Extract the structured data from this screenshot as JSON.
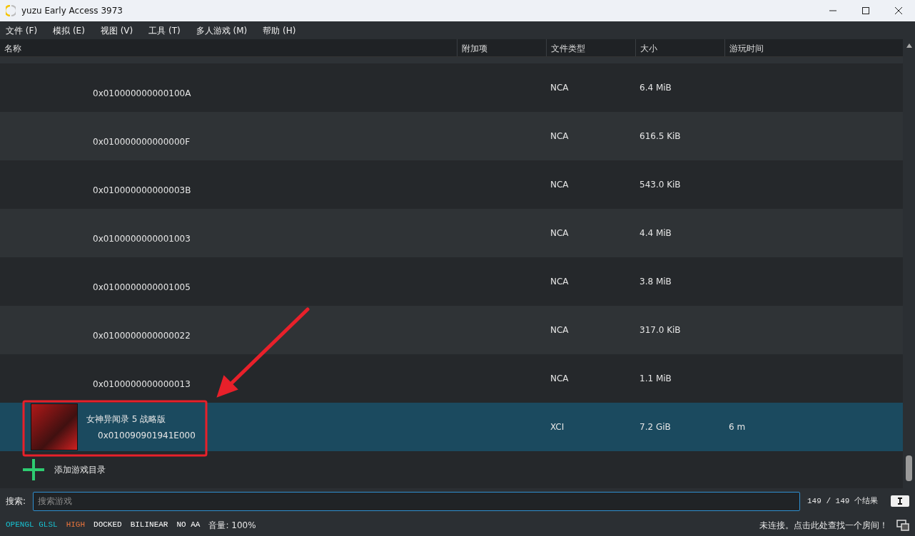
{
  "window": {
    "title": "yuzu Early Access 3973"
  },
  "menu": [
    "文件 (F)",
    "模拟 (E)",
    "视图 (V)",
    "工具 (T)",
    "多人游戏 (M)",
    "帮助 (H)"
  ],
  "table": {
    "columns": [
      "名称",
      "附加项",
      "文件类型",
      "大小",
      "游玩时间"
    ],
    "rows": [
      {
        "kind": "file",
        "id": "0x010000000000100A",
        "file_type": "NCA",
        "size": "6.4 MiB",
        "selected": false
      },
      {
        "kind": "file",
        "id": "0x010000000000000F",
        "file_type": "NCA",
        "size": "616.5 KiB",
        "selected": false
      },
      {
        "kind": "file",
        "id": "0x010000000000003B",
        "file_type": "NCA",
        "size": "543.0 KiB",
        "selected": false
      },
      {
        "kind": "file",
        "id": "0x0100000000001003",
        "file_type": "NCA",
        "size": "4.4 MiB",
        "selected": false
      },
      {
        "kind": "file",
        "id": "0x0100000000001005",
        "file_type": "NCA",
        "size": "3.8 MiB",
        "selected": false
      },
      {
        "kind": "file",
        "id": "0x0100000000000022",
        "file_type": "NCA",
        "size": "317.0 KiB",
        "selected": false
      },
      {
        "kind": "file",
        "id": "0x0100000000000013",
        "file_type": "NCA",
        "size": "1.1 MiB",
        "selected": false
      },
      {
        "kind": "game",
        "title": "女神异闻录 5  战略版",
        "id": "0x010090901941E000",
        "file_type": "XCI",
        "size": "7.2 GiB",
        "play_time": "6 m",
        "selected": true
      }
    ],
    "add_directory": "添加游戏目录"
  },
  "search": {
    "label": "搜索:",
    "placeholder": "搜索游戏",
    "result_count": "149 / 149 个结果"
  },
  "status_bar": {
    "items": [
      {
        "text": "OPENGL GLSL",
        "color": "#18c0d0"
      },
      {
        "text": "HIGH",
        "color": "#e8743c"
      },
      {
        "text": "DOCKED",
        "color": "#ffffff"
      },
      {
        "text": "BILINEAR",
        "color": "#ffffff"
      },
      {
        "text": "NO AA",
        "color": "#ffffff"
      }
    ],
    "volume": "音量: 100%",
    "network": "未连接。点击此处查找一个房间！"
  }
}
